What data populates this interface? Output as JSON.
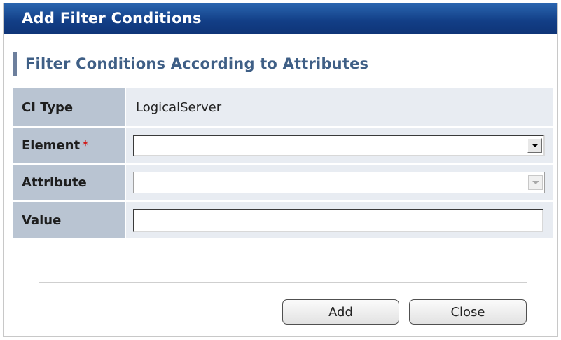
{
  "dialog": {
    "title": "Add Filter Conditions",
    "section_heading": "Filter Conditions According to Attributes"
  },
  "form": {
    "ci_type": {
      "label": "CI Type",
      "value": "LogicalServer"
    },
    "element": {
      "label": "Element",
      "required_mark": "*",
      "selected": ""
    },
    "attribute": {
      "label": "Attribute",
      "selected": ""
    },
    "value": {
      "label": "Value",
      "text": ""
    }
  },
  "buttons": {
    "add_label": "Add",
    "close_label": "Close"
  },
  "colors": {
    "titlebar": "#123e86",
    "label_cell": "#b9c4d2",
    "value_cell": "#e8ecf2",
    "heading_text": "#3f5f86",
    "required": "#d11c1c"
  },
  "icons": {
    "dropdown": "chevron-down-icon"
  }
}
